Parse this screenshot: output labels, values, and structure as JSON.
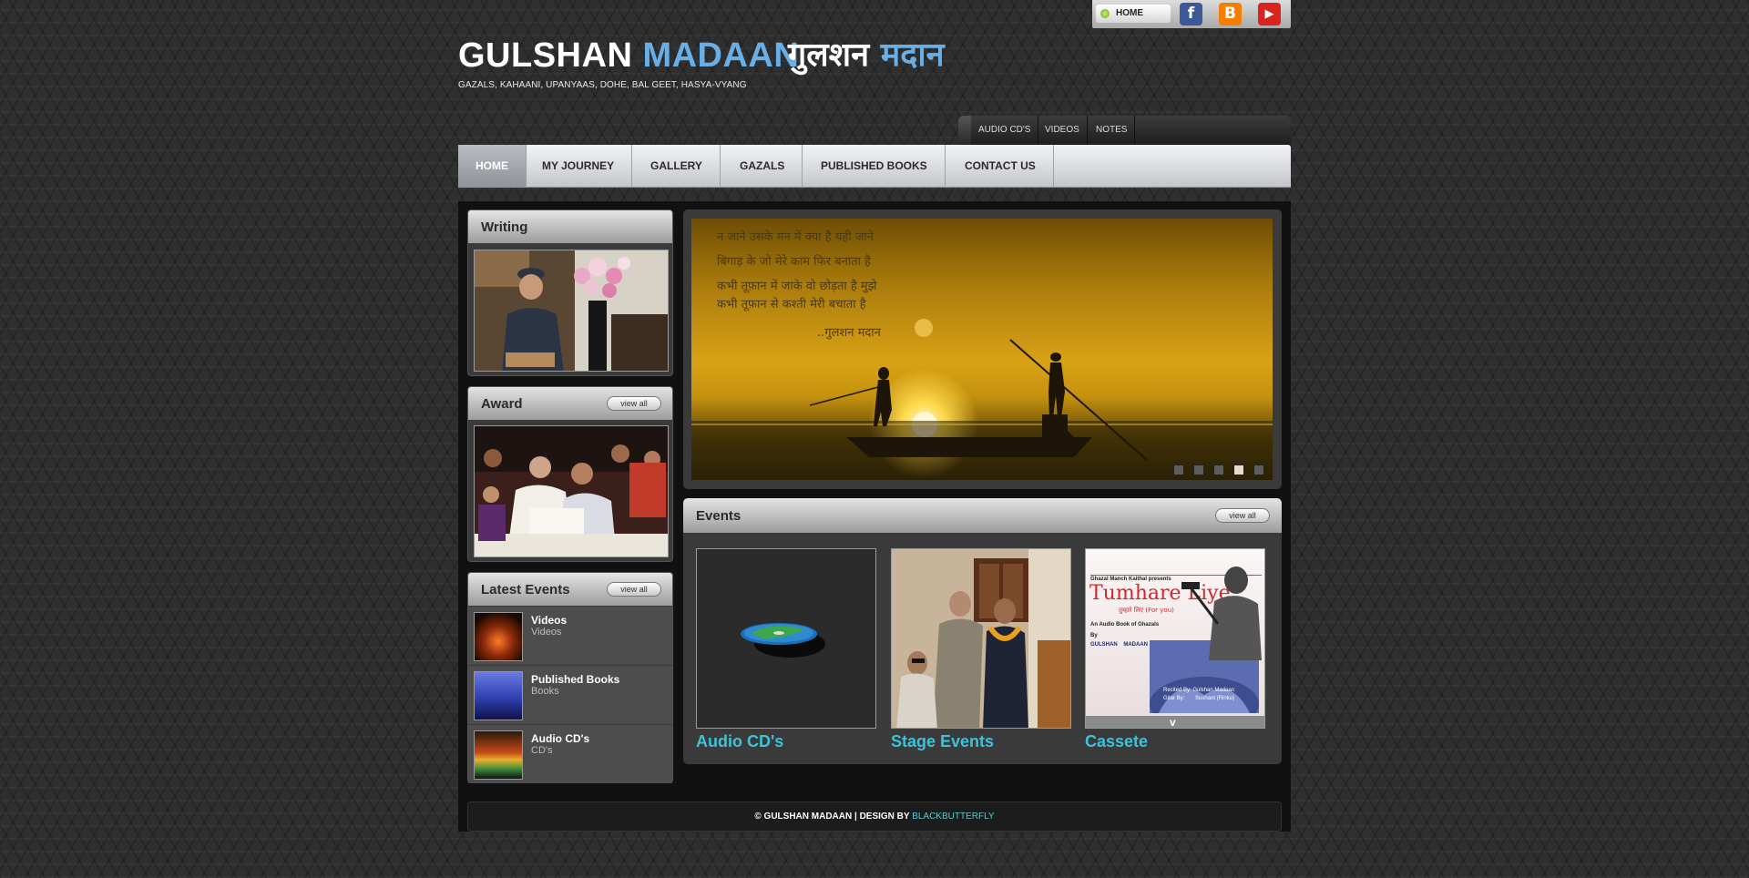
{
  "topbar": {
    "home_label": "HOME",
    "social": [
      {
        "name": "facebook-icon",
        "glyph": "f",
        "color": "#3b5998"
      },
      {
        "name": "blogger-icon",
        "glyph": "B",
        "color": "#f57d00"
      },
      {
        "name": "youtube-icon",
        "glyph": "▶",
        "color": "#d9231f"
      }
    ]
  },
  "header": {
    "brand_first": "GULSHAN",
    "brand_last": "MADAAN",
    "brand_hindi_first": "गुलशन",
    "brand_hindi_last": "मदान",
    "tagline": "GAZALS, KAHAANI, UPANYAAS, DOHE, BAL GEET, HASYA-VYANG"
  },
  "subnav": [
    "AUDIO CD'S",
    "VIDEOS",
    "NOTES"
  ],
  "nav": [
    "HOME",
    "MY JOURNEY",
    "GALLERY",
    "GAZALS",
    "PUBLISHED BOOKS",
    "CONTACT US"
  ],
  "sidebar": {
    "writing_title": "Writing",
    "award_title": "Award",
    "latest_title": "Latest Events",
    "view_all": "view all",
    "latest_events": [
      {
        "title": "Videos",
        "sub": "Videos"
      },
      {
        "title": "Published Books",
        "sub": "Books"
      },
      {
        "title": "Audio CD's",
        "sub": "CD's"
      }
    ]
  },
  "slider": {
    "poem": [
      "न जाने उसके मन में क्या है यही जाने",
      "बिगाड़ के जो मेरे काम फिर बनाता है",
      "कभी तूफ़ान में जाके वो छोड़ता है मुझे",
      "कभी  तूफ़ान  से कश्ती मेरी बचाता है"
    ],
    "signature": "..गुलशन मदान",
    "dots": 5,
    "active_dot": 4
  },
  "events": {
    "title": "Events",
    "view_all": "view all",
    "cards": [
      "Audio CD's",
      "Stage Events",
      "Cassete"
    ],
    "cassette": {
      "presenter": "Ghazal Manch Kaithal  presents",
      "title": "Tumhare Liye",
      "subtitle": "तुम्हारे लिए  (For you)",
      "desc": "An Audio Book of Ghazals",
      "by": "By",
      "author": "GULSHAN    MADAAN",
      "credit1": "Recited By: Gulshan Madaan",
      "credit2": "Gitar By:       Sushant (Rinku)"
    }
  },
  "footer": {
    "copy": "© GULSHAN MADAAN | DESIGN BY ",
    "designer": "BLACKBUTTERFLY"
  },
  "colors": {
    "accent_blue": "#6aaee6",
    "event_label": "#3bc3d8",
    "footer_accent": "#5cc9c9"
  }
}
